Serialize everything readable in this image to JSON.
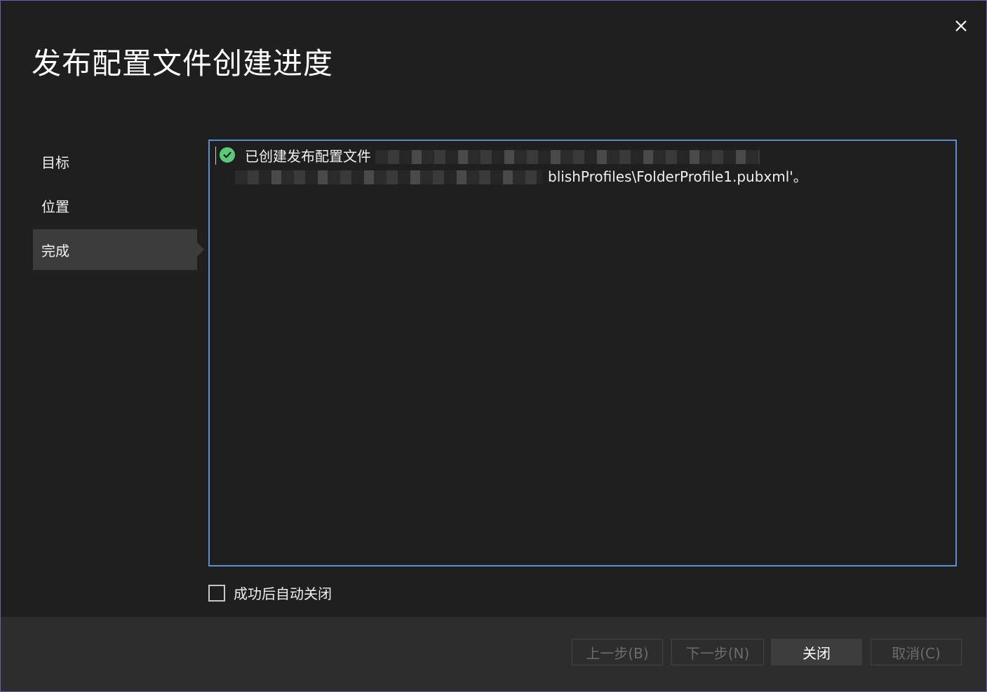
{
  "dialog": {
    "title": "发布配置文件创建进度",
    "close_icon": "close-icon"
  },
  "steps": [
    {
      "label": "目标",
      "active": false
    },
    {
      "label": "位置",
      "active": false
    },
    {
      "label": "完成",
      "active": true
    }
  ],
  "log": {
    "status_icon": "success-check-icon",
    "status_color": "#5cc97a",
    "message_prefix": "已创建发布配置文件",
    "message_suffix": "blishProfiles\\FolderProfile1.pubxml'。"
  },
  "options": {
    "auto_close_label": "成功后自动关闭",
    "auto_close_checked": false
  },
  "footer": {
    "prev_label": "上一步(B)",
    "next_label": "下一步(N)",
    "close_label": "关闭",
    "cancel_label": "取消(C)"
  },
  "colors": {
    "background": "#1f1f1f",
    "footer_background": "#2d2d2d",
    "panel_border": "#5a8fd6",
    "window_border": "#6b5fb5",
    "active_step": "#3c3c3c"
  }
}
